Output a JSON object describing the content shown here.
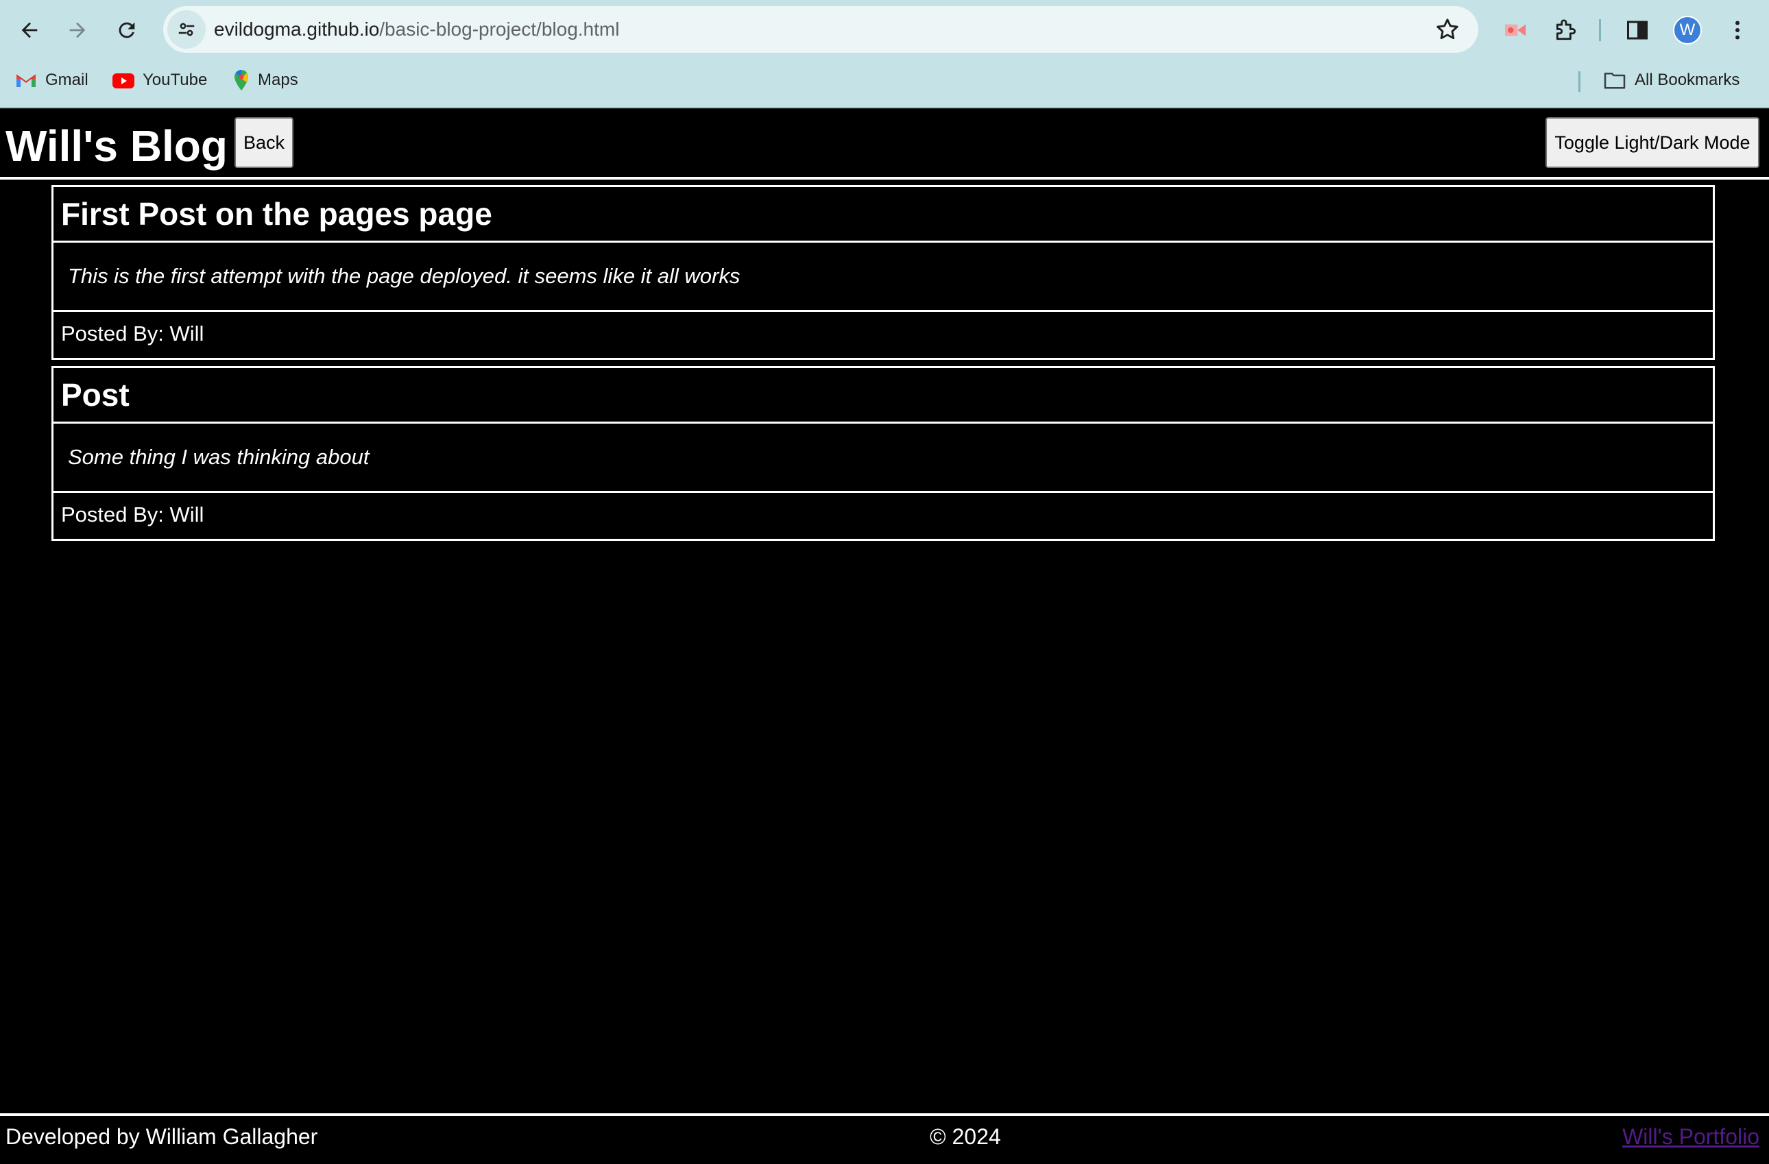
{
  "browser": {
    "url_host": "evildogma.github.io",
    "url_path": "/basic-blog-project/blog.html",
    "profile_initial": "W",
    "bookmarks": [
      {
        "label": "Gmail",
        "icon": "gmail-icon"
      },
      {
        "label": "YouTube",
        "icon": "youtube-icon"
      },
      {
        "label": "Maps",
        "icon": "maps-icon"
      }
    ],
    "all_bookmarks_label": "All Bookmarks"
  },
  "header": {
    "title": "Will's Blog",
    "back_label": "Back",
    "toggle_label": "Toggle Light/Dark Mode"
  },
  "posts": [
    {
      "title": "First Post on the pages page",
      "content": "This is the first attempt with the page deployed. it seems like it all works",
      "author": "Posted By: Will"
    },
    {
      "title": "Post",
      "content": "Some thing I was thinking about",
      "author": "Posted By: Will"
    }
  ],
  "footer": {
    "developer": "Developed by William Gallagher",
    "copyright": "© 2024",
    "portfolio_link": "Will's Portfolio"
  },
  "colors": {
    "page_background": "#000000",
    "text": "#ffffff",
    "chrome_background": "#c5e3e6",
    "visited_link": "#551a8b",
    "avatar": "#3b7fd6"
  }
}
